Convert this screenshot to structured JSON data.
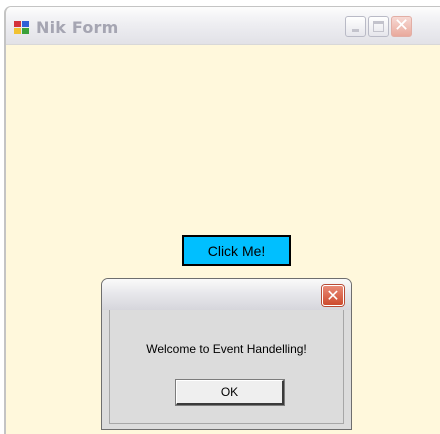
{
  "main_window": {
    "title": "Nik Form",
    "icon": "app-form-icon",
    "client_bg": "#fff8dc",
    "controls": {
      "minimize": "minimize-icon",
      "maximize": "maximize-icon",
      "close": "close-icon"
    }
  },
  "click_button": {
    "label": "Click Me!",
    "bg": "#00bfff"
  },
  "message_box": {
    "title": "",
    "close_icon": "close-icon",
    "close_glyph": "✕",
    "message": "Welcome to Event Handelling!",
    "ok_label": "OK"
  }
}
